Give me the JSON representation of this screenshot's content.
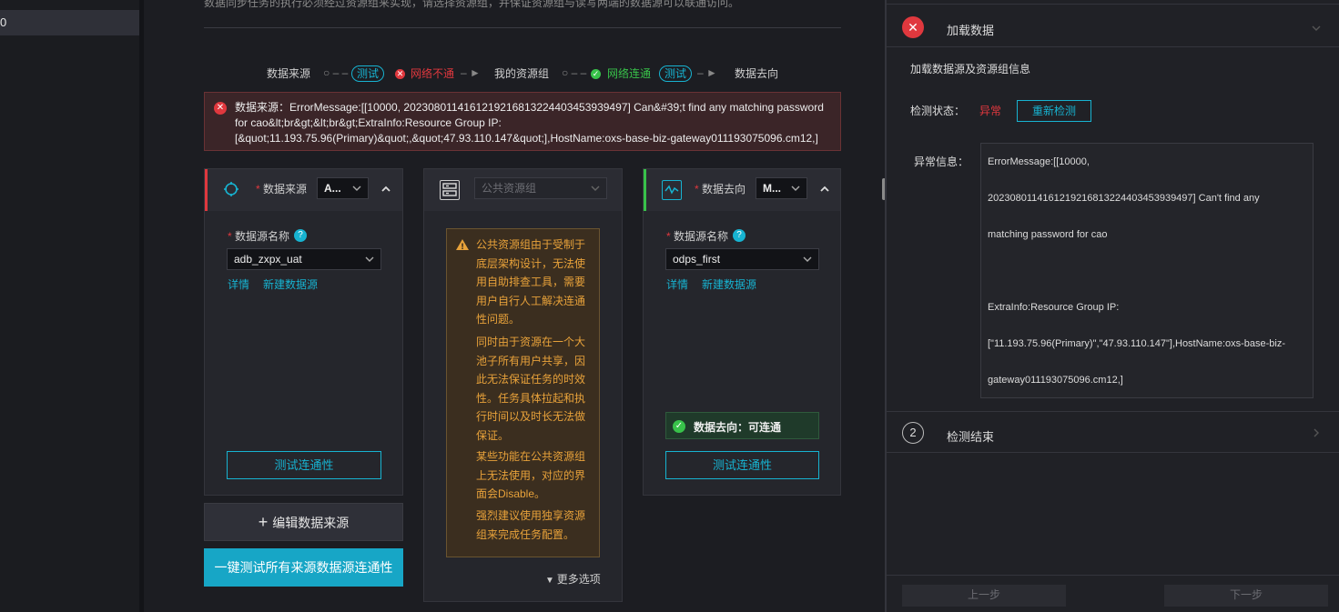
{
  "leftnav": {
    "selected_item": "0"
  },
  "header": {
    "hint": "数据同步任务的执行必须经过资源组来实现，请选择资源组，并保证资源组与读写两端的数据源可以联通访问。"
  },
  "flow": {
    "source_label": "数据来源",
    "test_label_1": "测试",
    "status_fail": "网络不通",
    "my_resource_group": "我的资源组",
    "status_ok": "网络连通",
    "test_label_2": "测试",
    "target_label": "数据去向",
    "colors": {
      "fail": "#e0383e",
      "ok": "#38c24a",
      "accent": "#17b3d1"
    }
  },
  "error_banner": {
    "text": "数据来源：ErrorMessage:[[10000, 2023080114161219216813224403453939497] Can&#39;t find any matching password for cao&lt;br&gt;&lt;br&gt;ExtraInfo:Resource Group IP: [&quot;11.193.75.96(Primary)&quot;,&quot;47.93.110.147&quot;],HostName:oxs-base-biz-gateway011193075096.cm12,]"
  },
  "source_card": {
    "title": "数据来源",
    "type_select": "A...",
    "name_label": "数据源名称",
    "name_value": "adb_zxpx_uat",
    "detail_link": "详情",
    "new_link": "新建数据源",
    "test_button": "测试连通性"
  },
  "resource_card": {
    "select_placeholder": "公共资源组",
    "warning_p1": "公共资源组由于受制于底层架构设计，无法使用自助排查工具，需要用户自行人工解决连通性问题。",
    "warning_p2": "同时由于资源在一个大池子所有用户共享，因此无法保证任务的时效性。任务具体拉起和执行时间以及时长无法做保证。",
    "warning_p3": "某些功能在公共资源组上无法使用，对应的界面会Disable。",
    "warning_p4": "强烈建议使用独享资源组来完成任务配置。",
    "more_options": "更多选项"
  },
  "target_card": {
    "title": "数据去向",
    "type_select": "M...",
    "name_label": "数据源名称",
    "name_value": "odps_first",
    "detail_link": "详情",
    "new_link": "新建数据源",
    "status_text": "数据去向：可连通",
    "test_button": "测试连通性"
  },
  "actions": {
    "edit_source": "编辑数据来源",
    "test_all": "一键测试所有来源数据源连通性"
  },
  "right_panel": {
    "step1_title": "加载数据",
    "section_title": "加载数据源及资源组信息",
    "check_status_label": "检测状态：",
    "check_status_value": "异常",
    "recheck_button": "重新检测",
    "error_info_label": "异常信息：",
    "error_lines": [
      "ErrorMessage:[[10000,",
      "2023080114161219216813224403453939497] Can't find any",
      "matching password for cao",
      "",
      "ExtraInfo:Resource Group IP:",
      "[\"11.193.75.96(Primary)\",\"47.93.110.147\"],HostName:oxs-base-biz-",
      "gateway011193075096.cm12,]"
    ],
    "step2_number": "2",
    "step2_title": "检测结束",
    "prev_button": "上一步",
    "next_button": "下一步"
  }
}
